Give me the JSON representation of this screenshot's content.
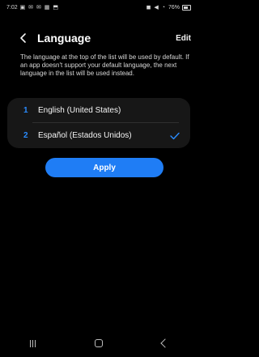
{
  "status_bar": {
    "time": "7:02",
    "left_icons": "▣ ✉ ✉ ▦ ⬒",
    "right_icons": "◼ ◀ ◔ ",
    "battery_text": "76%"
  },
  "header": {
    "title": "Language",
    "edit_label": "Edit"
  },
  "description": "The language at the top of the list will be used by default. If an app doesn't support your default language, the next language in the list will be used instead.",
  "languages": [
    {
      "number": "1",
      "label": "English (United States)"
    },
    {
      "number": "2",
      "label": "Español (Estados Unidos)"
    }
  ],
  "apply_label": "Apply",
  "colors": {
    "accent": "#1f7df5",
    "list_background": "#171717"
  },
  "icons": {
    "back": "chevron-left-icon",
    "check": "check-icon",
    "nav_recents": "recents-icon",
    "nav_home": "home-icon",
    "nav_back": "back-icon"
  }
}
